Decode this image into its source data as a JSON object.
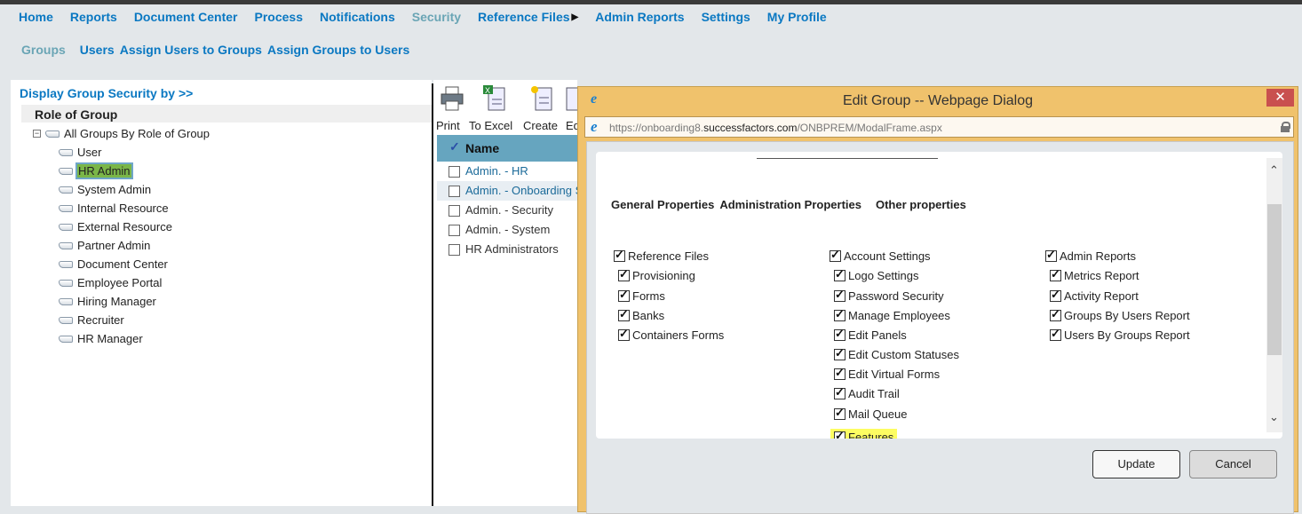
{
  "nav": {
    "items": [
      "Home",
      "Reports",
      "Document Center",
      "Process",
      "Notifications",
      "Security",
      "Reference Files",
      "Admin Reports",
      "Settings",
      "My Profile"
    ],
    "active": "Security"
  },
  "subnav": {
    "items": [
      "Groups",
      "Users",
      "Assign Users to Groups",
      "Assign Groups to Users"
    ],
    "active": "Groups"
  },
  "left": {
    "display_by": "Display Group Security by >>",
    "header": "Role of Group",
    "root": "All Groups By Role of Group",
    "groups": [
      "User",
      "HR Admin",
      "System Admin",
      "Internal Resource",
      "External Resource",
      "Partner Admin",
      "Document Center",
      "Employee Portal",
      "Hiring Manager",
      "Recruiter",
      "HR Manager"
    ],
    "selected": "HR Admin"
  },
  "toolbar": {
    "print": "Print",
    "excel": "To Excel",
    "create": "Create",
    "edit": "Ed"
  },
  "list": {
    "header": "Name",
    "rows": [
      "Admin. - HR",
      "Admin. - Onboarding S",
      "Admin. - Security",
      "Admin. - System",
      "HR Administrators"
    ]
  },
  "dialog": {
    "title": "Edit Group -- Webpage Dialog",
    "url_prefix": "https://onboarding8.",
    "url_domain": "successfactors.com",
    "url_path": "/ONBPREM/ModalFrame.aspx",
    "tabs": [
      "General Properties",
      "Administration Properties",
      "Other properties"
    ],
    "col1": {
      "header": "Reference Files",
      "items": [
        "Provisioning",
        "Forms",
        "Banks",
        "Containers Forms"
      ]
    },
    "col2": {
      "header": "Account Settings",
      "items": [
        "Logo Settings",
        "Password Security",
        "Manage Employees",
        "Edit Panels",
        "Edit Custom Statuses",
        "Edit Virtual Forms",
        "Audit Trail",
        "Mail Queue",
        "Features"
      ]
    },
    "col3": {
      "header": "Admin Reports",
      "items": [
        "Metrics Report",
        "Activity Report",
        "Groups By Users Report",
        "Users By Groups Report"
      ]
    },
    "highlighted": "Features",
    "update": "Update",
    "cancel": "Cancel"
  },
  "colors": {
    "link": "#0a78c2",
    "title_bar": "#f0c26c",
    "close": "#c9504f",
    "header": "#66a5bf",
    "highlight": "#fdfd62"
  }
}
